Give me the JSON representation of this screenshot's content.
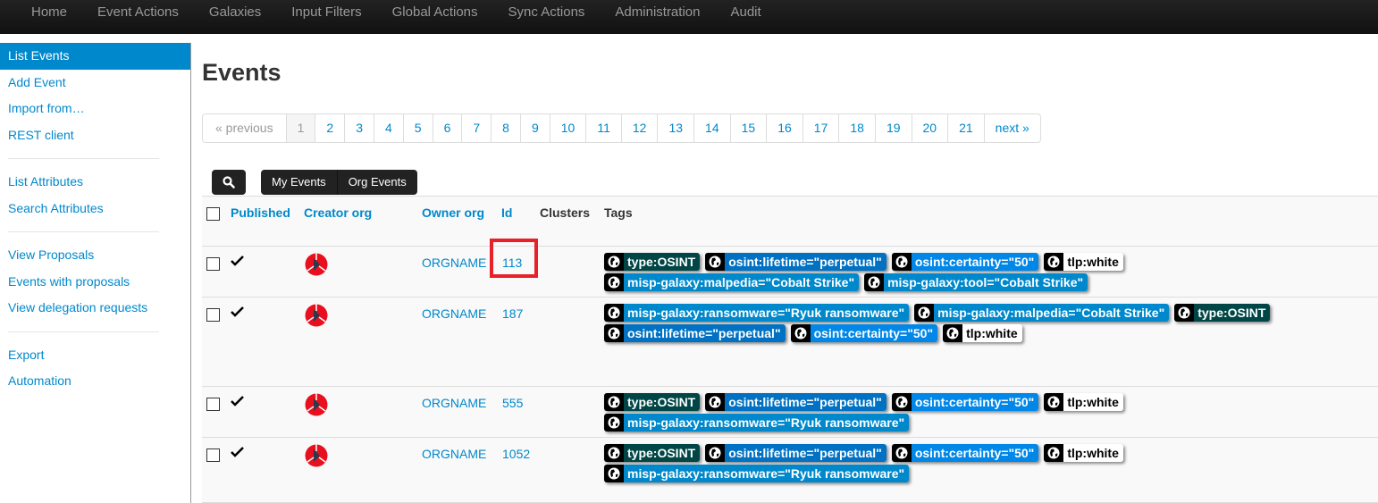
{
  "nav": [
    "Home",
    "Event Actions",
    "Galaxies",
    "Input Filters",
    "Global Actions",
    "Sync Actions",
    "Administration",
    "Audit"
  ],
  "sidebar": {
    "groups": [
      [
        "List Events",
        "Add Event",
        "Import from…",
        "REST client"
      ],
      [
        "List Attributes",
        "Search Attributes"
      ],
      [
        "View Proposals",
        "Events with proposals",
        "View delegation requests"
      ],
      [
        "Export",
        "Automation"
      ]
    ],
    "active": "List Events"
  },
  "title": "Events",
  "pager": {
    "prev": "« previous",
    "pages": [
      "1",
      "2",
      "3",
      "4",
      "5",
      "6",
      "7",
      "8",
      "9",
      "10",
      "11",
      "12",
      "13",
      "14",
      "15",
      "16",
      "17",
      "18",
      "19",
      "20",
      "21"
    ],
    "current": "1",
    "next": "next »"
  },
  "filters": {
    "my": "My Events",
    "org": "Org Events"
  },
  "columns": {
    "published": "Published",
    "creator": "Creator org",
    "owner": "Owner org",
    "id": "Id",
    "clusters": "Clusters",
    "tags": "Tags"
  },
  "tag_colors": {
    "type:OSINT": "#004646",
    "osint:lifetime=\"perpetual\"": "#0071c3",
    "osint:certainty=\"50\"": "#0087e8",
    "tlp:white": "#ffffff",
    "galaxy": "#0088cc"
  },
  "rows": [
    {
      "published": true,
      "owner": "ORGNAME",
      "id": "113",
      "highlighted": true,
      "tags": [
        "type:OSINT",
        "osint:lifetime=\"perpetual\"",
        "osint:certainty=\"50\"",
        "tlp:white",
        "misp-galaxy:malpedia=\"Cobalt Strike\"",
        "misp-galaxy:tool=\"Cobalt Strike\""
      ]
    },
    {
      "published": true,
      "owner": "ORGNAME",
      "id": "187",
      "tags": [
        "misp-galaxy:ransomware=\"Ryuk ransomware\"",
        "misp-galaxy:malpedia=\"Cobalt Strike\"",
        "type:OSINT",
        "osint:lifetime=\"perpetual\"",
        "osint:certainty=\"50\"",
        "tlp:white"
      ]
    },
    {
      "published": true,
      "owner": "ORGNAME",
      "id": "555",
      "tags": [
        "type:OSINT",
        "osint:lifetime=\"perpetual\"",
        "osint:certainty=\"50\"",
        "tlp:white",
        "misp-galaxy:ransomware=\"Ryuk ransomware\""
      ]
    },
    {
      "published": true,
      "owner": "ORGNAME",
      "id": "1052",
      "tags": [
        "type:OSINT",
        "osint:lifetime=\"perpetual\"",
        "osint:certainty=\"50\"",
        "tlp:white",
        "misp-galaxy:ransomware=\"Ryuk ransomware\""
      ]
    }
  ]
}
